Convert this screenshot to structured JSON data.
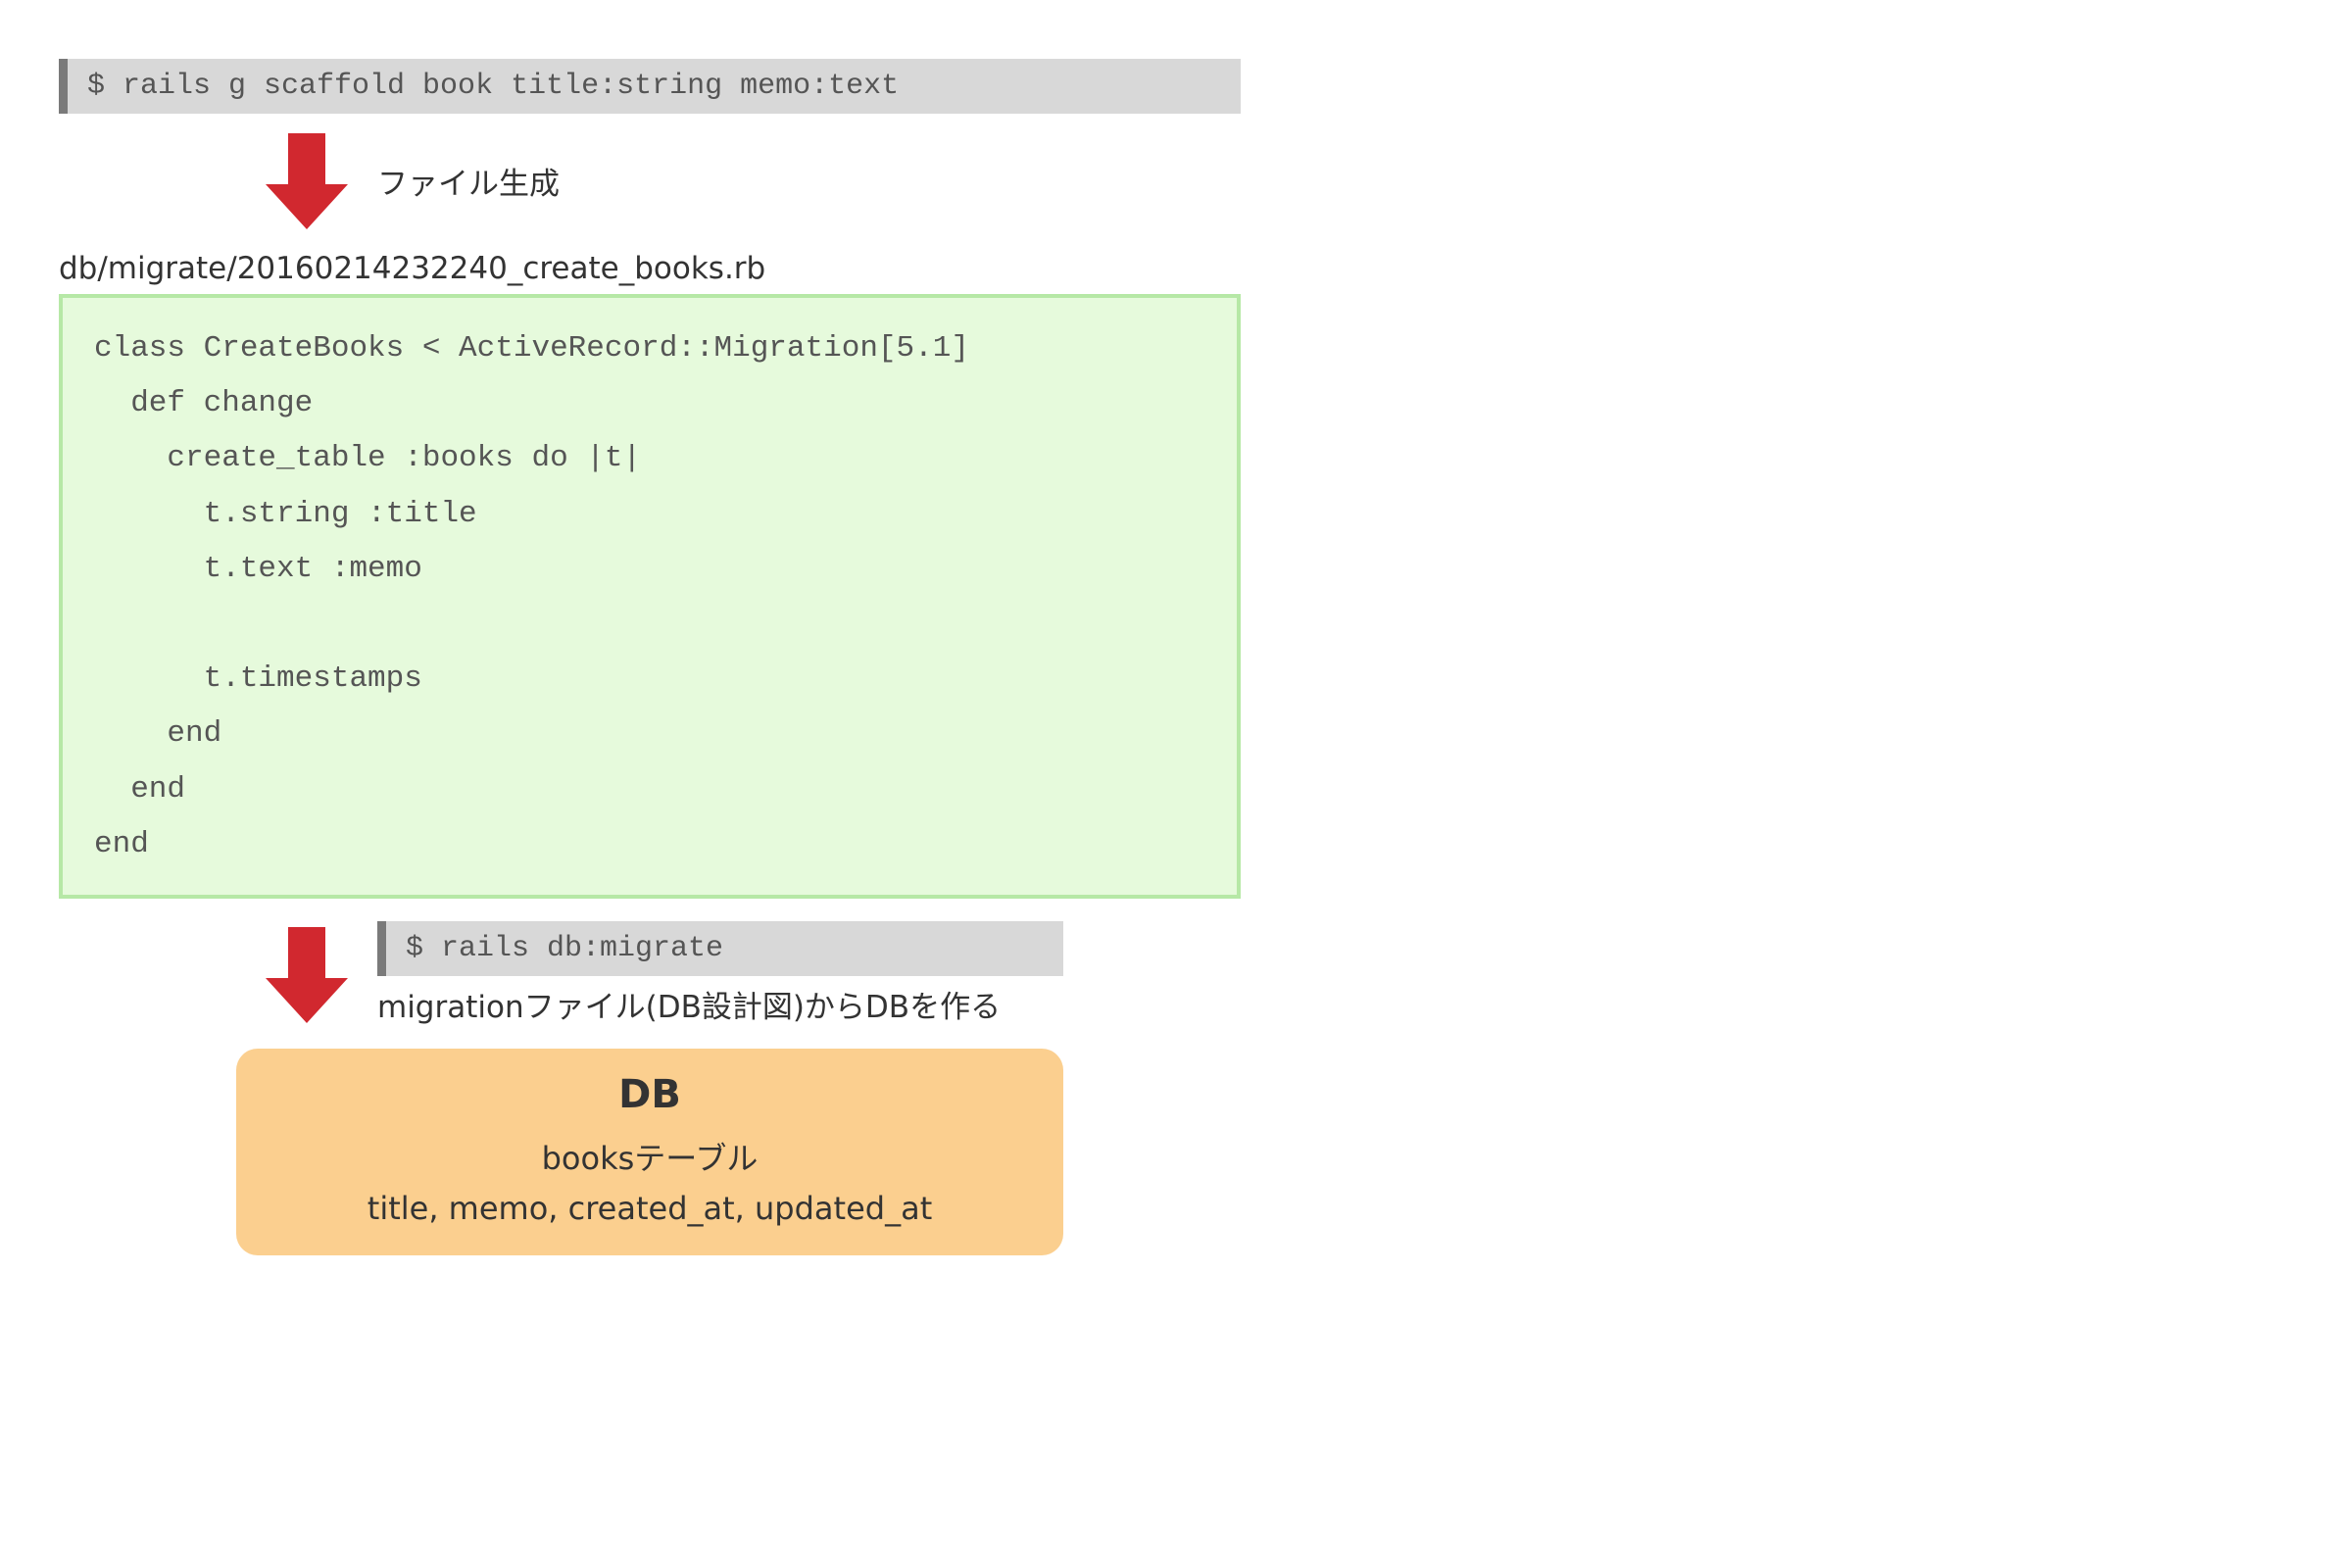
{
  "scaffold_command": "$ rails g scaffold book title:string memo:text",
  "file_generation_label": "ファイル生成",
  "migration_file_path": "db/migrate/20160214232240_create_books.rb",
  "migration_code": {
    "lines": [
      "class CreateBooks < ActiveRecord::Migration[5.1]",
      "  def change",
      "    create_table :books do |t|",
      "      t.string :title",
      "      t.text :memo",
      "",
      "      t.timestamps",
      "    end",
      "  end",
      "end"
    ]
  },
  "migrate_command": "$ rails db:migrate",
  "migrate_description": "migrationファイル(DB設計図)からDBを作る",
  "db": {
    "title": "DB",
    "table_name": "booksテーブル",
    "columns": "title, memo, created_at, updated_at"
  },
  "colors": {
    "arrow": "#d1282f",
    "command_bg": "#d8d8d8",
    "command_bar": "#7a7a7a",
    "code_bg": "#e6fadc",
    "code_border": "#b6e8a6",
    "db_bg": "#fbcf8f"
  }
}
